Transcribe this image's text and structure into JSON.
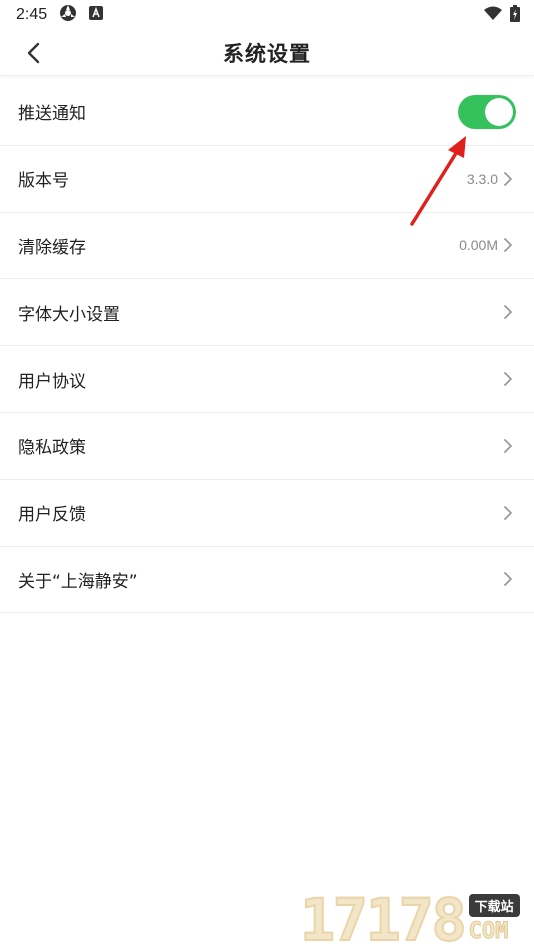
{
  "status_bar": {
    "time": "2:45",
    "icons": [
      "settings-sync-icon",
      "font-app-icon",
      "wifi-icon",
      "battery-charging-icon"
    ]
  },
  "header": {
    "back_icon": "chevron-left-icon",
    "title": "系统设置"
  },
  "settings": [
    {
      "label": "推送通知",
      "type": "toggle",
      "on": true
    },
    {
      "label": "版本号",
      "type": "value",
      "value": "3.3.0"
    },
    {
      "label": "清除缓存",
      "type": "value",
      "value": "0.00M"
    },
    {
      "label": "字体大小设置",
      "type": "link"
    },
    {
      "label": "用户协议",
      "type": "link"
    },
    {
      "label": "隐私政策",
      "type": "link"
    },
    {
      "label": "用户反馈",
      "type": "link"
    },
    {
      "label": "关于“上海静安”",
      "type": "link"
    }
  ],
  "watermark": {
    "digits": "17178",
    "badge": "下载站",
    "suffix": "COM"
  },
  "colors": {
    "toggle_on": "#35c25c",
    "annotation_arrow": "#e0201b",
    "chevron": "#9a9a9a"
  }
}
